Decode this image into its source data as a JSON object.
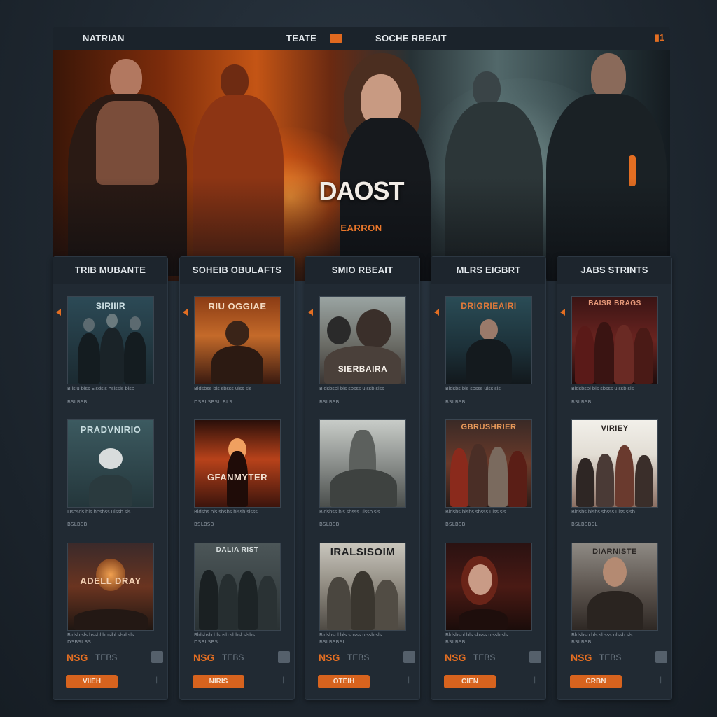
{
  "nav": {
    "brand": "NATRIAN",
    "link_1": "TEATE",
    "link_2": "SOCHE RBEAIT",
    "corner": "1"
  },
  "hero": {
    "title": "DAOST",
    "subtitle": "EARRON"
  },
  "columns": [
    {
      "header": "TRIB MUBANTE",
      "price": "NSG",
      "price_label": "TEBS",
      "cta": "VIIEH",
      "posters": [
        {
          "title": "SIRIIIR",
          "meta1": "Bilsiu blss Elsdsis hslssis blsb",
          "meta2": "BSLBSB"
        },
        {
          "title": "PRADVNIRIO",
          "meta1": "Dsbsds bls hbsbss ulssb sls",
          "meta2": "BSLBSB"
        },
        {
          "title": "ADELL DRAY",
          "meta1": "Bldsb sls bssbl bbsibl slsd sls",
          "meta2": "DSBSLBS"
        }
      ]
    },
    {
      "header": "SOHEIB OBULAFTS",
      "price": "NSG",
      "price_label": "TEBS",
      "cta": "NIRIS",
      "posters": [
        {
          "title": "RIU OGGIAE",
          "meta1": "Bldsbss bls sbsss ulss sis",
          "meta2": "DSBLSBSL BLS"
        },
        {
          "title": "GFANMYTER",
          "meta1": "Bldsbs bls sbsbs blssb slsss",
          "meta2": "BSLBSB"
        },
        {
          "title": "DALIA RIST",
          "meta1": "Bldsbsb blsbsb sbbsl slsbs",
          "meta2": "DSBLSBS"
        }
      ]
    },
    {
      "header": "SMIO RBEAIT",
      "price": "NSG",
      "price_label": "TEBS",
      "cta": "OTEIH",
      "posters": [
        {
          "title": "SIERBAIRA",
          "meta1": "Bldsbsbl bls sbsss ulssb slss",
          "meta2": "BSLBSB"
        },
        {
          "title": "",
          "meta1": "Bldsbss bls sbsss ulssb sls",
          "meta2": "BSLBSB"
        },
        {
          "title": "IRALSISOIM",
          "meta1": "Bldsbsbl bls sbsss ulssb sls",
          "meta2": "BSLBSBSL"
        }
      ]
    },
    {
      "header": "MLRS EIGBRT",
      "price": "NSG",
      "price_label": "TEBS",
      "cta": "CIEN",
      "posters": [
        {
          "title": "DRIGRIEAIRI",
          "meta1": "Bldsbs bls sbsss ulss sls",
          "meta2": "BSLBSB"
        },
        {
          "title": "GBRUSHRIER",
          "meta1": "Bldsbs blsbs sbsss ulss sls",
          "meta2": "BSLBSB"
        },
        {
          "title": "",
          "meta1": "Bldsbsbl bls sbsss ulssb sls",
          "meta2": "BSLBSB"
        }
      ]
    },
    {
      "header": "JABS STRINTS",
      "price": "NSG",
      "price_label": "TEBS",
      "cta": "CRBN",
      "posters": [
        {
          "title": "BAISR BRAGS",
          "meta1": "Bldsbsbl bls sbsss ulssb sls",
          "meta2": "BSLBSB"
        },
        {
          "title": "VIRIEY",
          "meta1": "Bldsbs blsbs sbsss ulss slsb",
          "meta2": "BSLBSBSL"
        },
        {
          "title": "DIARNISTE",
          "meta1": "Bldsbsb bls sbsss ulssb sls",
          "meta2": "BSLBSB"
        }
      ]
    }
  ],
  "colors": {
    "accent": "#e36e22",
    "panel": "#212a33",
    "background": "#1f2831"
  }
}
